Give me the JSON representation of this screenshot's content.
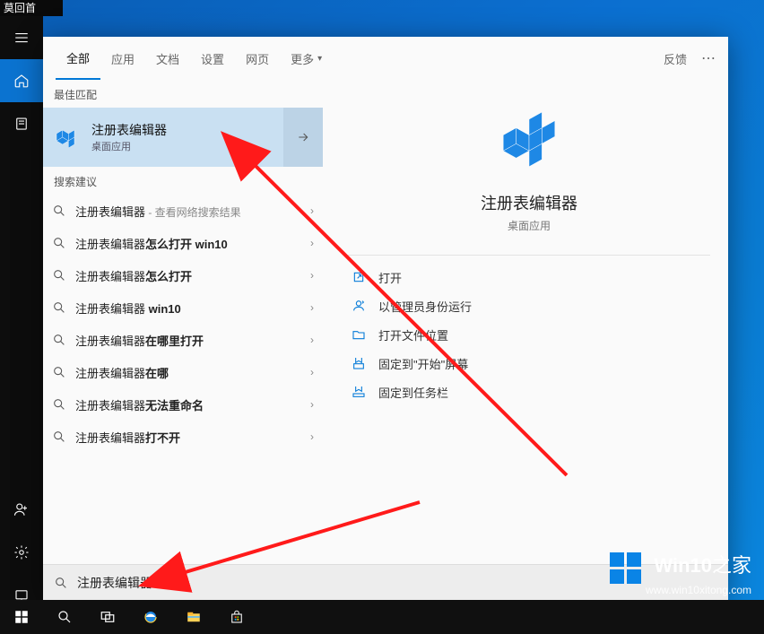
{
  "top_fragment": "莫回首",
  "rail": {
    "items": [
      "menu",
      "home",
      "recent",
      "contacts",
      "settings",
      "screenshot"
    ]
  },
  "tabs": {
    "items": [
      "全部",
      "应用",
      "文档",
      "设置",
      "网页"
    ],
    "more": "更多",
    "active_index": 0,
    "feedback": "反馈"
  },
  "left": {
    "best_match_label": "最佳匹配",
    "best_match": {
      "title": "注册表编辑器",
      "subtitle": "桌面应用"
    },
    "suggestions_label": "搜索建议",
    "suggestions": [
      {
        "prefix": "注册表编辑器",
        "bold": "",
        "hint": " - 查看网络搜索结果"
      },
      {
        "prefix": "注册表编辑器",
        "bold": "怎么打开 win10",
        "hint": ""
      },
      {
        "prefix": "注册表编辑器",
        "bold": "怎么打开",
        "hint": ""
      },
      {
        "prefix": "注册表编辑器",
        "bold": " win10",
        "hint": ""
      },
      {
        "prefix": "注册表编辑器",
        "bold": "在哪里打开",
        "hint": ""
      },
      {
        "prefix": "注册表编辑器",
        "bold": "在哪",
        "hint": ""
      },
      {
        "prefix": "注册表编辑器",
        "bold": "无法重命名",
        "hint": ""
      },
      {
        "prefix": "注册表编辑器",
        "bold": "打不开",
        "hint": ""
      }
    ]
  },
  "right": {
    "title": "注册表编辑器",
    "subtitle": "桌面应用",
    "actions": [
      "打开",
      "以管理员身份运行",
      "打开文件位置",
      "固定到\"开始\"屏幕",
      "固定到任务栏"
    ]
  },
  "search_value": "注册表编辑器",
  "watermark": {
    "brand_a": "Win10",
    "brand_b": "之家",
    "url": "www.win10xitong.com"
  }
}
